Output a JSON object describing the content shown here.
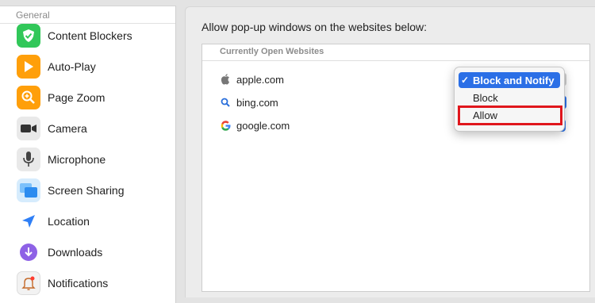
{
  "sidebar": {
    "header": "General",
    "items": [
      {
        "label": "Content Blockers",
        "icon": "content-blockers-icon",
        "color": "#31c759"
      },
      {
        "label": "Auto-Play",
        "icon": "auto-play-icon",
        "color": "#ff9f0a"
      },
      {
        "label": "Page Zoom",
        "icon": "page-zoom-icon",
        "color": "#ff9f0a"
      },
      {
        "label": "Camera",
        "icon": "camera-icon",
        "color": "#8e8e93"
      },
      {
        "label": "Microphone",
        "icon": "microphone-icon",
        "color": "#8e8e93"
      },
      {
        "label": "Screen Sharing",
        "icon": "screen-sharing-icon",
        "color": "#4fa8f7"
      },
      {
        "label": "Location",
        "icon": "location-icon",
        "color": "#2f7ff6"
      },
      {
        "label": "Downloads",
        "icon": "downloads-icon",
        "color": "#8e62e6"
      },
      {
        "label": "Notifications",
        "icon": "notifications-icon",
        "color": "#ff3b30"
      }
    ]
  },
  "main": {
    "title": "Allow pop-up windows on the websites below:",
    "list_header": "Currently Open Websites",
    "sites": [
      {
        "label": "apple.com",
        "icon": "apple-icon"
      },
      {
        "label": "bing.com",
        "icon": "bing-search-icon"
      },
      {
        "label": "google.com",
        "icon": "google-icon"
      }
    ]
  },
  "menu": {
    "options": [
      {
        "label": "Block and Notify",
        "selected": true
      },
      {
        "label": "Block",
        "selected": false
      },
      {
        "label": "Allow",
        "selected": false,
        "highlighted": true
      }
    ],
    "check_glyph": "✓",
    "highlight_color": "#e0161c",
    "accent_color": "#2b6fe6"
  }
}
